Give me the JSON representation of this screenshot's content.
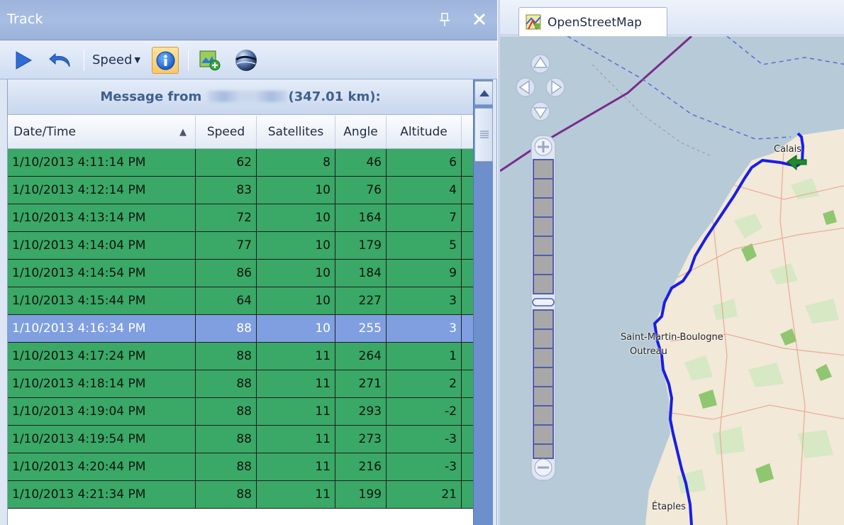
{
  "track_panel": {
    "title": "Track",
    "toolbar": {
      "speed_label": "Speed"
    }
  },
  "grid": {
    "caption_prefix": "Message from",
    "caption_suffix": "(347.01 km):",
    "columns": [
      "Date/Time",
      "Speed",
      "Satellites",
      "Angle",
      "Altitude"
    ],
    "rows": [
      {
        "datetime": "1/10/2013 4:11:14 PM",
        "speed": "62",
        "satellites": "8",
        "angle": "46",
        "altitude": "6"
      },
      {
        "datetime": "1/10/2013 4:12:14 PM",
        "speed": "83",
        "satellites": "10",
        "angle": "76",
        "altitude": "4"
      },
      {
        "datetime": "1/10/2013 4:13:14 PM",
        "speed": "72",
        "satellites": "10",
        "angle": "164",
        "altitude": "7"
      },
      {
        "datetime": "1/10/2013 4:14:04 PM",
        "speed": "77",
        "satellites": "10",
        "angle": "179",
        "altitude": "5"
      },
      {
        "datetime": "1/10/2013 4:14:54 PM",
        "speed": "86",
        "satellites": "10",
        "angle": "184",
        "altitude": "9"
      },
      {
        "datetime": "1/10/2013 4:15:44 PM",
        "speed": "64",
        "satellites": "10",
        "angle": "227",
        "altitude": "3"
      },
      {
        "datetime": "1/10/2013 4:16:34 PM",
        "speed": "88",
        "satellites": "10",
        "angle": "255",
        "altitude": "3",
        "selected": true
      },
      {
        "datetime": "1/10/2013 4:17:24 PM",
        "speed": "88",
        "satellites": "11",
        "angle": "264",
        "altitude": "1"
      },
      {
        "datetime": "1/10/2013 4:18:14 PM",
        "speed": "88",
        "satellites": "11",
        "angle": "271",
        "altitude": "2"
      },
      {
        "datetime": "1/10/2013 4:19:04 PM",
        "speed": "88",
        "satellites": "11",
        "angle": "293",
        "altitude": "-2"
      },
      {
        "datetime": "1/10/2013 4:19:54 PM",
        "speed": "88",
        "satellites": "11",
        "angle": "273",
        "altitude": "-3"
      },
      {
        "datetime": "1/10/2013 4:20:44 PM",
        "speed": "88",
        "satellites": "11",
        "angle": "216",
        "altitude": "-3"
      },
      {
        "datetime": "1/10/2013 4:21:34 PM",
        "speed": "88",
        "satellites": "11",
        "angle": "199",
        "altitude": "21"
      }
    ]
  },
  "map_panel": {
    "tab_label": "OpenStreetMap",
    "places": {
      "calais": "Calais",
      "saint_martin": "Saint-Martin-Boulogne",
      "outreau": "Outreau",
      "etaples": "Étaples"
    }
  },
  "colors": {
    "row_green": "#3aa866",
    "row_selected": "#7f9fe0",
    "route_blue": "#1a1ee6",
    "land": "#f2e9d8",
    "sea": "#b6cbd7"
  },
  "icons": {
    "play": "play-icon",
    "undo": "undo-icon",
    "info": "info-icon",
    "export_map": "map-export-icon",
    "globe": "globe-icon",
    "pin": "pin-icon",
    "close": "close-icon",
    "osm": "osm-logo-icon",
    "direction_arrow": "direction-arrow-icon"
  }
}
